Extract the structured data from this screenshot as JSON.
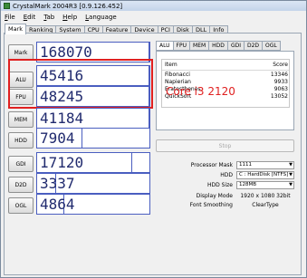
{
  "window": {
    "title": "CrystalMark 2004R3 [0.9.126.452]"
  },
  "menu": [
    "File",
    "Edit",
    "Tab",
    "Help",
    "Language"
  ],
  "tabs": [
    "Mark",
    "Ranking",
    "System",
    "CPU",
    "Feature",
    "Device",
    "PCI",
    "Disk",
    "DLL",
    "Info"
  ],
  "scores": [
    {
      "label": "Mark",
      "value": "168070",
      "fill": 1.0
    },
    {
      "label": "ALU",
      "value": "45416",
      "fill": 1.0
    },
    {
      "label": "FPU",
      "value": "48245",
      "fill": 1.0
    },
    {
      "label": "MEM",
      "value": "41184",
      "fill": 1.0
    },
    {
      "label": "HDD",
      "value": "7904",
      "fill": 0.4
    },
    {
      "label": "GDI",
      "value": "17120",
      "fill": 0.85
    },
    {
      "label": "D2D",
      "value": "3337",
      "fill": 0.17
    },
    {
      "label": "OGL",
      "value": "4864",
      "fill": 0.24
    }
  ],
  "detail_tabs": [
    "ALU",
    "FPU",
    "MEM",
    "HDD",
    "GDI",
    "D2D",
    "OGL"
  ],
  "detail_table": {
    "headers": [
      "Item",
      "Score"
    ],
    "rows": [
      {
        "item": "Fibonacci",
        "score": "13346"
      },
      {
        "item": "Napierian",
        "score": "9933"
      },
      {
        "item": "Eratosthenes",
        "score": "9063"
      },
      {
        "item": "QuickSort",
        "score": "13052"
      }
    ]
  },
  "annotation": "Core i3 2120",
  "stop_label": "Stop",
  "settings": [
    {
      "label": "Processor Mask",
      "value": "1111",
      "kind": "select"
    },
    {
      "label": "HDD",
      "value": "C : HardDisk [NTFS]",
      "kind": "select"
    },
    {
      "label": "HDD Size",
      "value": "128MB",
      "kind": "select"
    },
    {
      "label": "Display Mode",
      "value": "1920 x 1080 32bit",
      "kind": "text"
    },
    {
      "label": "Font Smoothing",
      "value": "ClearType",
      "kind": "text"
    }
  ],
  "colors": {
    "score_text": "#202a6e",
    "score_border": "#4a5ec0",
    "highlight": "#e02020"
  }
}
